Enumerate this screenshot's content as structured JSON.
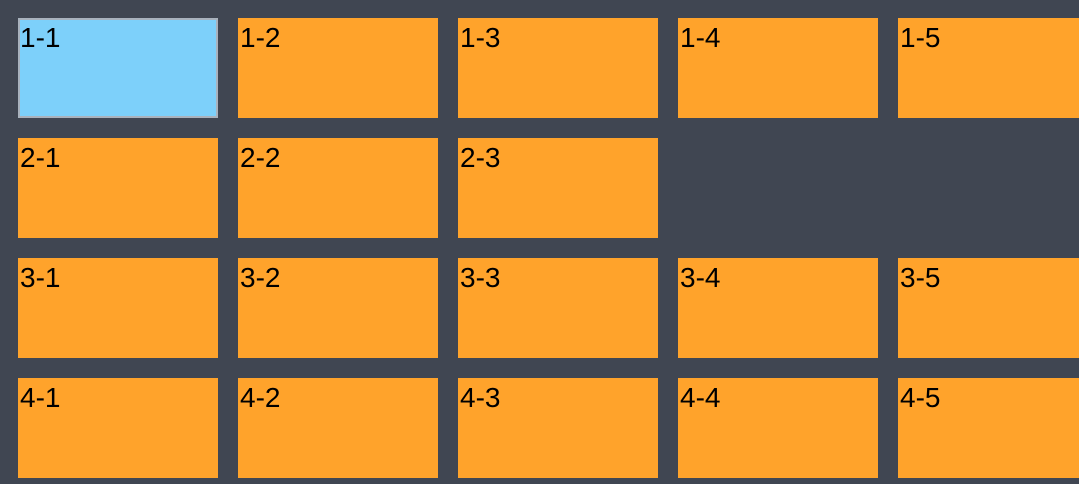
{
  "colors": {
    "background": "#404652",
    "tile": "#FFA32B",
    "selected_tile": "#7DD0FA",
    "selected_border": "#A9B2BD"
  },
  "selected_tile": "1-1",
  "rows": [
    {
      "tiles": [
        "1-1",
        "1-2",
        "1-3",
        "1-4",
        "1-5"
      ]
    },
    {
      "tiles": [
        "2-1",
        "2-2",
        "2-3"
      ]
    },
    {
      "tiles": [
        "3-1",
        "3-2",
        "3-3",
        "3-4",
        "3-5"
      ]
    },
    {
      "tiles": [
        "4-1",
        "4-2",
        "4-3",
        "4-4",
        "4-5"
      ]
    }
  ]
}
